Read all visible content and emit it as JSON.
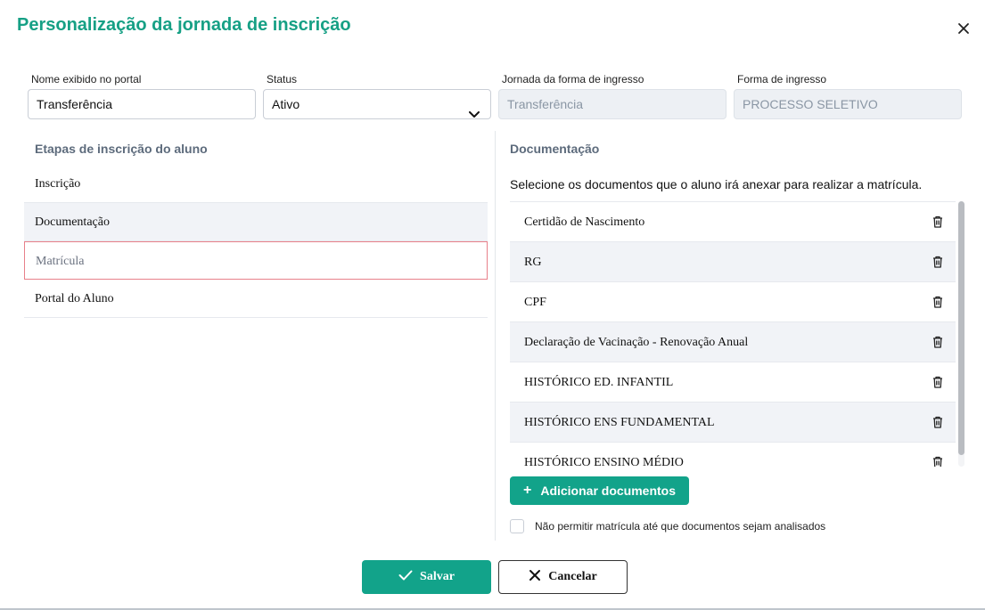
{
  "title": "Personalização da jornada de inscrição",
  "form": {
    "display_name_label": "Nome exibido no portal",
    "display_name_value": "Transferência",
    "status_label": "Status",
    "status_value": "Ativo",
    "journey_label": "Jornada da forma de ingresso",
    "journey_value": "Transferência",
    "entry_form_label": "Forma de ingresso",
    "entry_form_value": "PROCESSO SELETIVO"
  },
  "steps": {
    "title": "Etapas de inscrição do aluno",
    "items": [
      {
        "label": "Inscrição"
      },
      {
        "label": "Documentação"
      },
      {
        "label": "Matrícula"
      },
      {
        "label": "Portal do Aluno"
      }
    ]
  },
  "documents": {
    "title": "Documentação",
    "description": "Selecione os documentos que o aluno irá anexar para realizar a matrícula.",
    "items": [
      {
        "label": "Certidão de Nascimento"
      },
      {
        "label": "RG"
      },
      {
        "label": "CPF"
      },
      {
        "label": "Declaração de Vacinação - Renovação Anual"
      },
      {
        "label": "HISTÓRICO ED. INFANTIL"
      },
      {
        "label": "HISTÓRICO ENS FUNDAMENTAL"
      },
      {
        "label": "HISTÓRICO ENSINO MÉDIO"
      }
    ],
    "add_button_label": "Adicionar documentos",
    "checkbox_label": "Não permitir matrícula até que documentos sejam analisados",
    "checkbox_checked": false
  },
  "footer": {
    "save_label": "Salvar",
    "cancel_label": "Cancelar"
  },
  "colors": {
    "accent": "#16a085",
    "button": "#12a38a",
    "selected_border": "#e8808a"
  }
}
